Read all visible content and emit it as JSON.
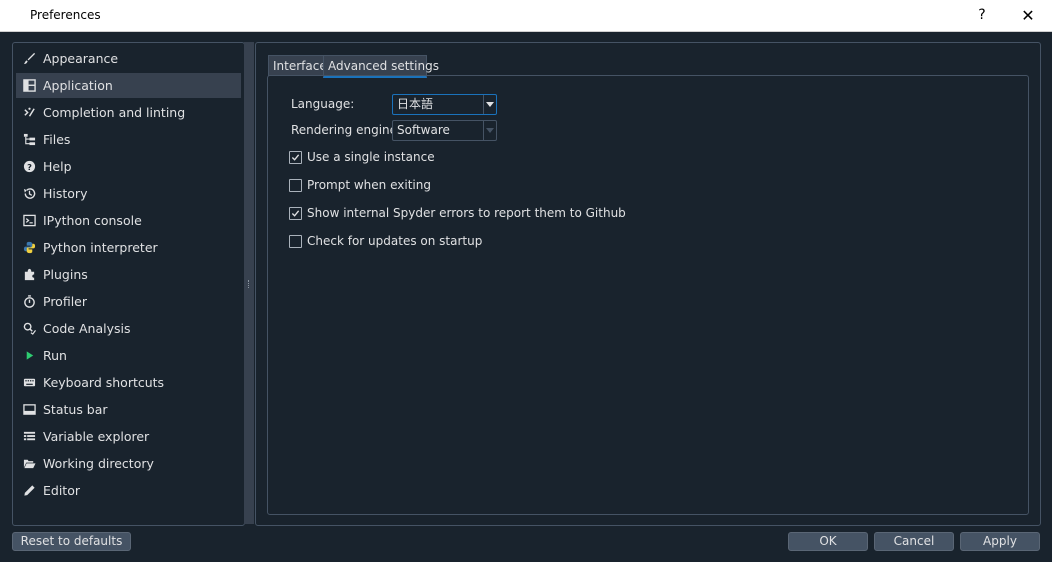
{
  "window": {
    "title": "Preferences",
    "help_label": "?",
    "close_label": "✕"
  },
  "sidebar": {
    "items": [
      {
        "label": "Appearance",
        "icon": "paint-brush-icon"
      },
      {
        "label": "Application",
        "icon": "application-icon",
        "selected": true
      },
      {
        "label": "Completion and linting",
        "icon": "completion-icon"
      },
      {
        "label": "Files",
        "icon": "files-icon"
      },
      {
        "label": "Help",
        "icon": "help-icon"
      },
      {
        "label": "History",
        "icon": "history-icon"
      },
      {
        "label": "IPython console",
        "icon": "console-icon"
      },
      {
        "label": "Python interpreter",
        "icon": "python-icon"
      },
      {
        "label": "Plugins",
        "icon": "puzzle-icon"
      },
      {
        "label": "Profiler",
        "icon": "stopwatch-icon"
      },
      {
        "label": "Code Analysis",
        "icon": "code-analysis-icon"
      },
      {
        "label": "Run",
        "icon": "play-icon"
      },
      {
        "label": "Keyboard shortcuts",
        "icon": "keyboard-icon"
      },
      {
        "label": "Status bar",
        "icon": "statusbar-icon"
      },
      {
        "label": "Variable explorer",
        "icon": "table-icon"
      },
      {
        "label": "Working directory",
        "icon": "folder-open-icon"
      },
      {
        "label": "Editor",
        "icon": "pencil-icon"
      }
    ]
  },
  "tabs": [
    {
      "label": "Interface",
      "active": false
    },
    {
      "label": "Advanced settings",
      "active": true
    }
  ],
  "advanced": {
    "language_label": "Language:",
    "language_value": "日本語",
    "rendering_label": "Rendering engine:",
    "rendering_value": "Software",
    "checkboxes": [
      {
        "label": "Use a single instance",
        "checked": true
      },
      {
        "label": "Prompt when exiting",
        "checked": false
      },
      {
        "label": "Show internal Spyder errors to report them to Github",
        "checked": true
      },
      {
        "label": "Check for updates on startup",
        "checked": false
      }
    ]
  },
  "buttons": {
    "reset": "Reset to defaults",
    "ok": "OK",
    "cancel": "Cancel",
    "apply": "Apply"
  },
  "colors": {
    "background": "#19232d",
    "selected": "#37414f",
    "accent": "#1a72bb",
    "run_icon": "#2ecc71",
    "python_blue": "#3b78b0",
    "python_yellow": "#f0d040"
  }
}
